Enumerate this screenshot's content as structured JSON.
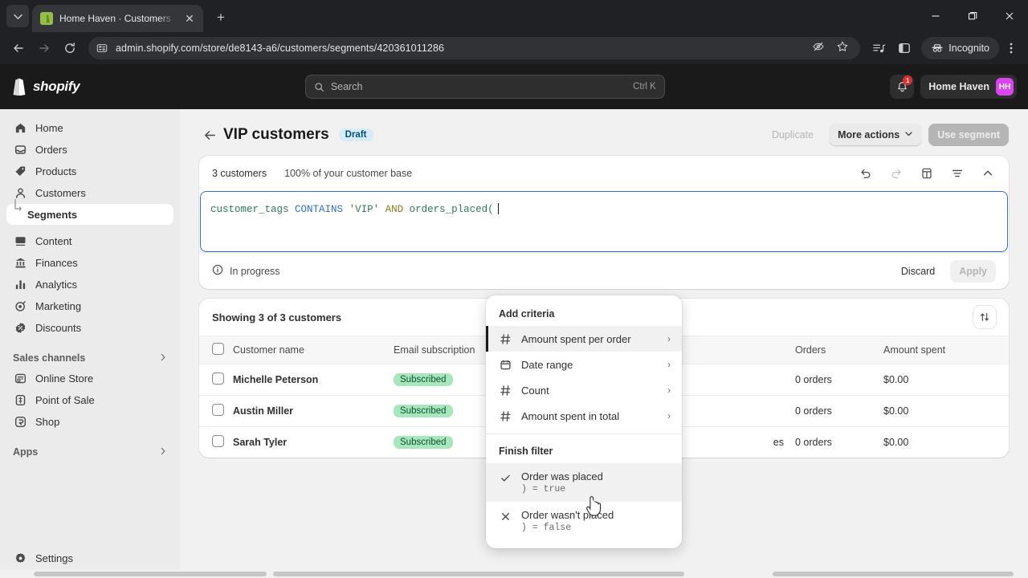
{
  "browser": {
    "tab_title": "Home Haven · Customers · Sho",
    "url": "admin.shopify.com/store/de8143-a6/customers/segments/420361011286",
    "incognito_label": "Incognito",
    "new_tab_label": "+",
    "close_label": "✕",
    "minimize_label": "—",
    "maximize_label": "❐",
    "window_close_label": "✕"
  },
  "topbar": {
    "brand": "shopify",
    "search_placeholder": "Search",
    "search_shortcut": "Ctrl K",
    "notification_count": "1",
    "store_name": "Home Haven",
    "avatar_initials": "HH"
  },
  "sidebar": {
    "items": [
      {
        "label": "Home",
        "icon": "home-icon"
      },
      {
        "label": "Orders",
        "icon": "orders-icon"
      },
      {
        "label": "Products",
        "icon": "tag-icon"
      },
      {
        "label": "Customers",
        "icon": "person-icon"
      },
      {
        "label": "Segments",
        "icon": "sub-arrow-icon"
      },
      {
        "label": "Content",
        "icon": "content-icon"
      },
      {
        "label": "Finances",
        "icon": "bank-icon"
      },
      {
        "label": "Analytics",
        "icon": "bar-chart-icon"
      },
      {
        "label": "Marketing",
        "icon": "target-icon"
      },
      {
        "label": "Discounts",
        "icon": "discount-icon"
      }
    ],
    "sales_channels_header": "Sales channels",
    "channels": [
      {
        "label": "Online Store",
        "icon": "store-icon"
      },
      {
        "label": "Point of Sale",
        "icon": "pos-icon"
      },
      {
        "label": "Shop",
        "icon": "shop-icon"
      }
    ],
    "apps_header": "Apps",
    "settings_label": "Settings"
  },
  "page": {
    "title": "VIP customers",
    "status_badge": "Draft",
    "duplicate_label": "Duplicate",
    "more_actions_label": "More actions",
    "use_segment_label": "Use segment"
  },
  "query_card": {
    "customer_count": "3 customers",
    "base_percent": "100% of your customer base",
    "tools": [
      "undo-icon",
      "redo-icon",
      "template-icon",
      "filter-icon",
      "collapse-icon"
    ],
    "query_tokens": [
      {
        "text": "customer_tags",
        "kind": "field"
      },
      {
        "text": " ",
        "kind": "plain"
      },
      {
        "text": "CONTAINS",
        "kind": "op"
      },
      {
        "text": " ",
        "kind": "plain"
      },
      {
        "text": "'VIP'",
        "kind": "str"
      },
      {
        "text": " ",
        "kind": "plain"
      },
      {
        "text": "AND",
        "kind": "and"
      },
      {
        "text": " ",
        "kind": "plain"
      },
      {
        "text": "orders_placed(",
        "kind": "field"
      }
    ],
    "status_text": "In progress",
    "discard_label": "Discard",
    "apply_label": "Apply"
  },
  "popover": {
    "add_criteria_header": "Add criteria",
    "criteria": [
      {
        "label": "Amount spent per order",
        "icon": "hash-icon",
        "chevron": "›",
        "selected": true
      },
      {
        "label": "Date range",
        "icon": "calendar-icon",
        "chevron": "›",
        "selected": false
      },
      {
        "label": "Count",
        "icon": "hash-icon",
        "chevron": "›",
        "selected": false
      },
      {
        "label": "Amount spent in total",
        "icon": "hash-icon",
        "chevron": "›",
        "selected": false
      }
    ],
    "finish_filter_header": "Finish filter",
    "finish": [
      {
        "label": "Order was placed",
        "sub": ") = true",
        "icon": "check-icon",
        "selected": true
      },
      {
        "label": "Order wasn't placed",
        "sub": ") = false",
        "icon": "x-icon",
        "selected": false
      }
    ]
  },
  "table": {
    "showing_text": "Showing 3 of 3 customers",
    "sort_icon": "sort-icon",
    "columns": [
      "Customer name",
      "Email subscription",
      "",
      "Orders",
      "Amount spent"
    ],
    "rows": [
      {
        "name": "Michelle Peterson",
        "email_subscription": "Subscribed",
        "location": "",
        "orders": "0 orders",
        "amount_spent": "$0.00"
      },
      {
        "name": "Austin Miller",
        "email_subscription": "Subscribed",
        "location": "",
        "orders": "0 orders",
        "amount_spent": "$0.00"
      },
      {
        "name": "Sarah Tyler",
        "email_subscription": "Subscribed",
        "location": "es",
        "orders": "0 orders",
        "amount_spent": "$0.00"
      }
    ]
  },
  "colors": {
    "brand_dark": "#1a1a1a",
    "draft_badge_bg": "#d6ecf7",
    "subscribed_bg": "#a8e6bd",
    "editor_border": "#2f6ecb",
    "avatar_bg": "#d946ef"
  }
}
